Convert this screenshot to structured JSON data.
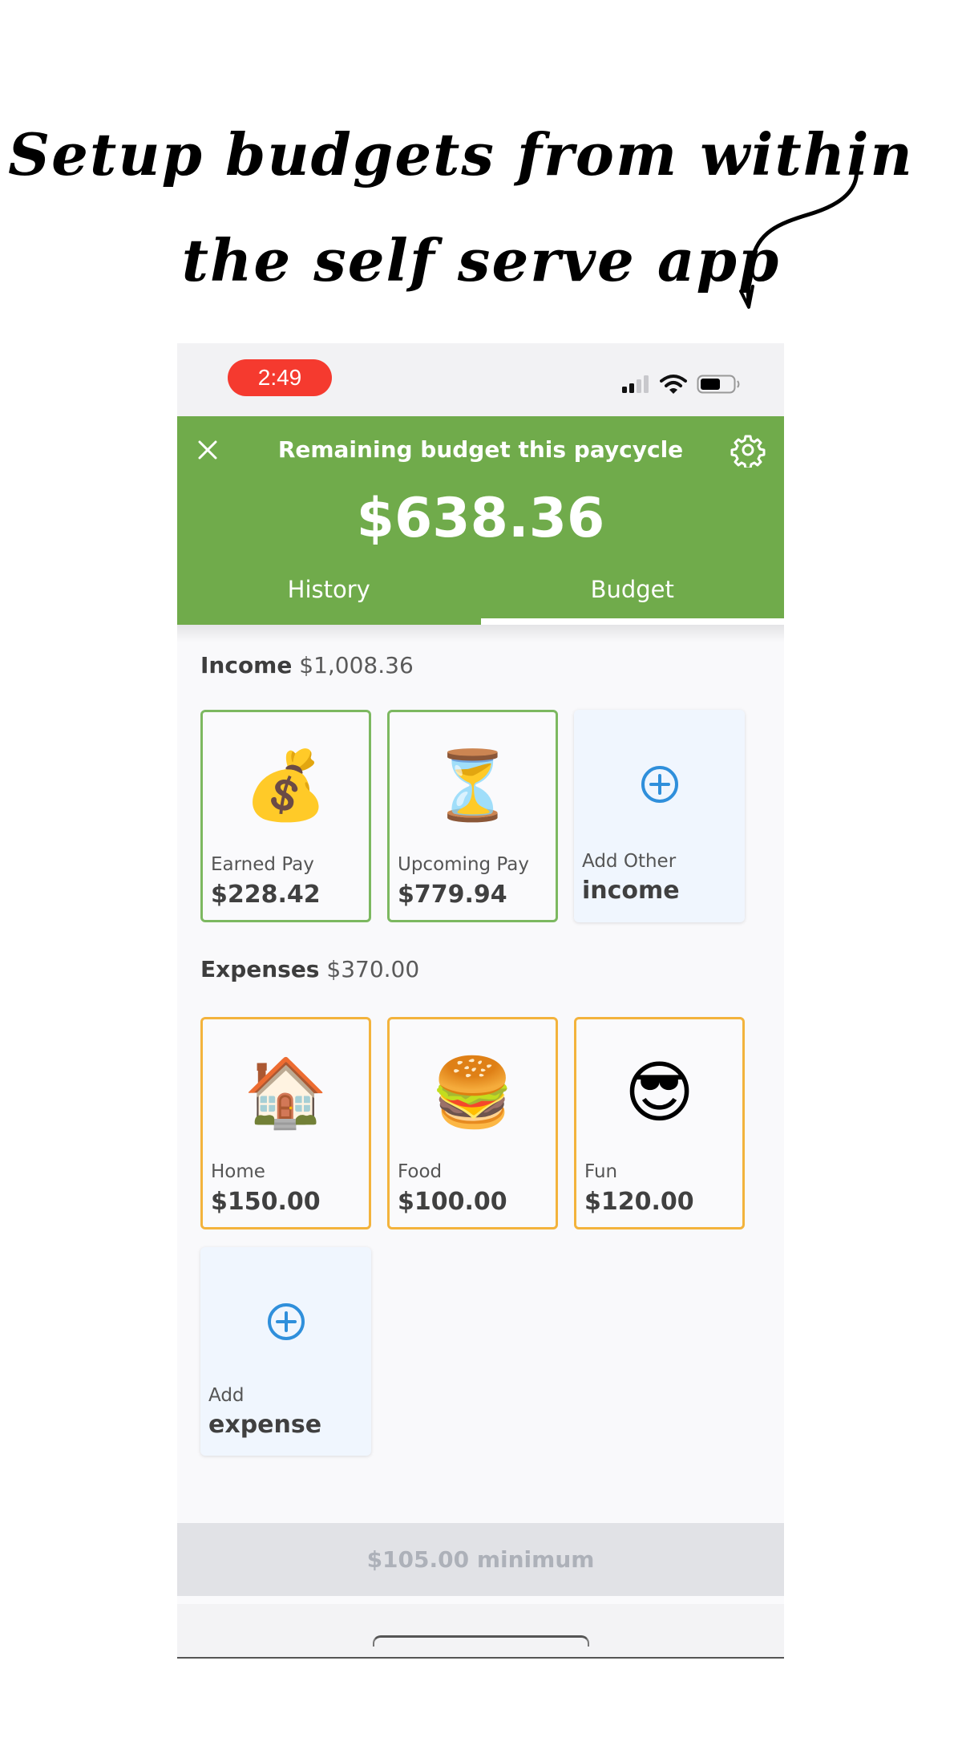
{
  "caption": {
    "line1": "Setup budgets from within",
    "line2": "the self serve app"
  },
  "status_bar": {
    "time": "2:49",
    "icons": [
      "cellular-signal-icon",
      "wifi-icon",
      "battery-icon"
    ]
  },
  "header": {
    "title": "Remaining budget this paycycle",
    "balance": "$638.36",
    "close_icon": "close-icon",
    "settings_icon": "gear-icon",
    "brand_color": "#70ab4b"
  },
  "tabs": [
    {
      "label": "History",
      "active": false
    },
    {
      "label": "Budget",
      "active": true
    }
  ],
  "income": {
    "label": "Income",
    "total": "$1,008.36",
    "cards": [
      {
        "emoji": "💰",
        "icon": "money-bag-icon",
        "name": "Earned Pay",
        "value": "$228.42"
      },
      {
        "emoji": "⏳",
        "icon": "hourglass-icon",
        "name": "Upcoming Pay",
        "value": "$779.94"
      }
    ],
    "add_card": {
      "name": "Add Other",
      "value": "income"
    }
  },
  "expenses": {
    "label": "Expenses",
    "total": "$370.00",
    "cards": [
      {
        "emoji": "🏠",
        "icon": "house-icon",
        "name": "Home",
        "value": "$150.00"
      },
      {
        "emoji": "🍔",
        "icon": "burger-icon",
        "name": "Food",
        "value": "$100.00"
      },
      {
        "emoji": "😎",
        "icon": "sunglasses-face-icon",
        "name": "Fun",
        "value": "$120.00"
      }
    ],
    "add_card": {
      "name": "Add",
      "value": "expense"
    }
  },
  "footer": {
    "minimum_button": "$105.00 minimum"
  },
  "colors": {
    "income_border": "#7cb860",
    "expense_border": "#f3b33c",
    "add_accent": "#2f8fdb",
    "status_time_bg": "#f53a2f"
  }
}
